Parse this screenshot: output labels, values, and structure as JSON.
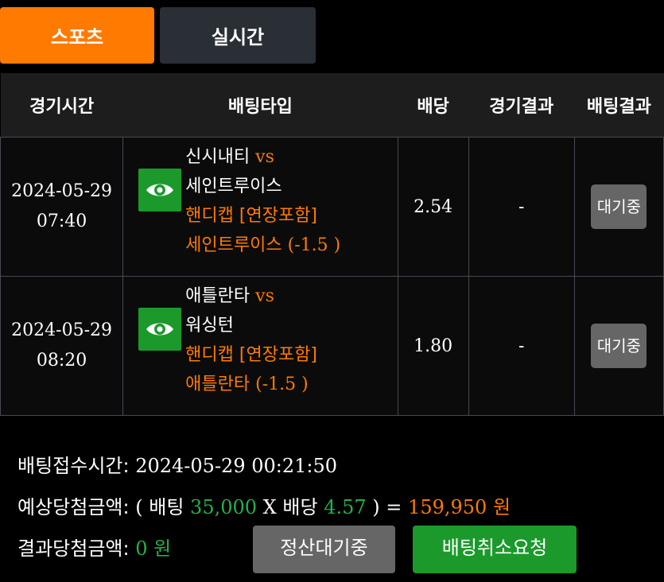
{
  "tabs": {
    "sports": "스포츠",
    "live": "실시간"
  },
  "headers": [
    "경기시간",
    "배팅타입",
    "배당",
    "경기결과",
    "배팅결과"
  ],
  "rows": [
    {
      "date": "2024-05-29",
      "time": "07:40",
      "home": "신시내티",
      "vs": "vs",
      "away": "세인트루이스",
      "bet_type": "핸디캡 [연장포함]",
      "pick_team": "세인트루이스",
      "pick_line": "(-1.5 )",
      "odds": "2.54",
      "game_result": "-",
      "bet_result": "대기중"
    },
    {
      "date": "2024-05-29",
      "time": "08:20",
      "home": "애틀란타",
      "vs": "vs",
      "away": "워싱턴",
      "bet_type": "핸디캡 [연장포함]",
      "pick_team": "애틀란타",
      "pick_line": "(-1.5 )",
      "odds": "1.80",
      "game_result": "-",
      "bet_result": "대기중"
    }
  ],
  "footer": {
    "received_label": "배팅접수시간:",
    "received_value": "2024-05-29 00:21:50",
    "expected_label": "예상당첨금액:",
    "open_paren": "(",
    "bet_word": "배팅",
    "bet_amount": "35,000",
    "times": "X",
    "odds_word": "배당",
    "total_odds": "4.57",
    "close_eq": ") =",
    "expected_amount": "159,950",
    "won": "원",
    "result_label": "결과당첨금액:",
    "result_amount": "0",
    "result_won": "원",
    "settle_button": "정산대기중",
    "cancel_button": "배팅취소요청"
  },
  "colors": {
    "accent": "#ff7a00",
    "green": "#1b9a2b",
    "tab_dark": "#2a2f36"
  },
  "icons": {
    "view": "eye-icon"
  }
}
